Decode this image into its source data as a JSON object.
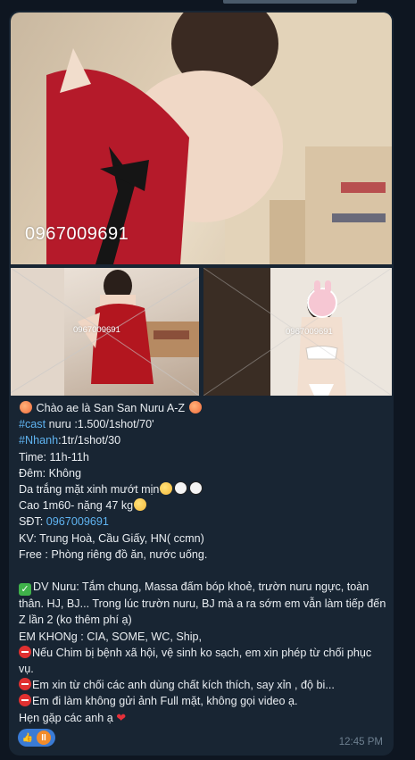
{
  "photos": {
    "main_watermark": "0967009691",
    "left_watermark": "0967009691",
    "right_watermark": "0967009691"
  },
  "message": {
    "greeting": "Chào ae là San San Nuru A-Z",
    "cast_tag": "#cast",
    "cast_text": " nuru :1.500/1shot/70'",
    "nhanh_tag": "#Nhanh",
    "nhanh_text": ":1tr/1shot/30",
    "time_line": "Time: 11h-11h",
    "night_line": "Đêm: Không",
    "skin_line": "Da trắng mặt xinh mướt mịn",
    "height_line": "Cao 1m60- nặng 47 kg",
    "phone_label": "SĐT: ",
    "phone": "0967009691",
    "area_line": "KV:  Trung Hoà, Cầu Giấy, HN( ccmn)",
    "free_line": "Free : Phòng riêng đồ ăn, nước uống.",
    "dv_line": "DV Nuru: Tắm chung, Massa đấm bóp khoẻ, trườn nuru ngực, toàn thân. HJ, BJ... Trong lúc trườn nuru, BJ mà a ra sớm em vẫn làm tiếp đến Z lần 2 (ko thêm phí ạ)",
    "no_line": " EM KHONg : CIA, SOME, WC, Ship,",
    "warn1": "Nếu Chim bị bệnh xã hội, vệ sinh ko sạch, em xin phép từ chối phục vụ.",
    "warn2": "Em xin từ chối các anh dùng chất kích thích, say xỉn , độ bi...",
    "warn3": "Em đi làm không gửi ảnh Full mặt, không gọi video ạ.",
    "closing": "Hẹn gặp các anh ạ"
  },
  "reactions": {
    "like": "👍",
    "avatar_letter": "II"
  },
  "timestamp": "12:45 PM",
  "colors": {
    "background": "#0e1621",
    "bubble": "#182533",
    "link": "#5fb3f0",
    "reaction_bg": "#3a7bd5",
    "time": "#6d7f8f"
  }
}
